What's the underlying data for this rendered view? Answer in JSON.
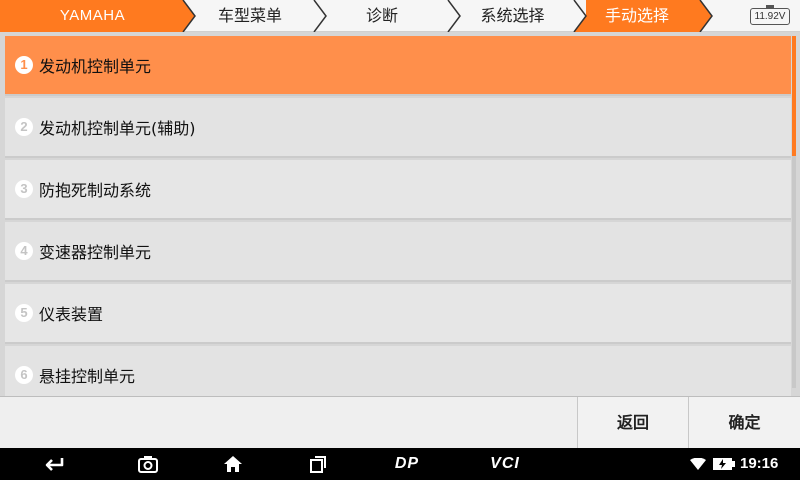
{
  "breadcrumb": {
    "items": [
      "YAMAHA",
      "车型菜单",
      "诊断",
      "系统选择",
      "手动选择"
    ],
    "active_color": "#ff7a1f"
  },
  "battery": {
    "voltage": "11.92V"
  },
  "list": {
    "items": [
      {
        "number": "1",
        "label": "发动机控制单元",
        "selected": true
      },
      {
        "number": "2",
        "label": "发动机控制单元(辅助)",
        "selected": false
      },
      {
        "number": "3",
        "label": "防抱死制动系统",
        "selected": false
      },
      {
        "number": "4",
        "label": "变速器控制单元",
        "selected": false
      },
      {
        "number": "5",
        "label": "仪表装置",
        "selected": false
      },
      {
        "number": "6",
        "label": "悬挂控制单元",
        "selected": false
      }
    ],
    "selected_color": "#ff8f4b"
  },
  "buttons": {
    "back": "返回",
    "confirm": "确定"
  },
  "navbar": {
    "icons": [
      "back-arrow-icon",
      "camera-icon",
      "home-icon",
      "recent-apps-icon",
      "dp-icon",
      "vci-icon",
      "wifi-icon",
      "battery-charging-icon"
    ],
    "dp_label": "DP",
    "vci_label": "VCI",
    "time": "19:16"
  }
}
